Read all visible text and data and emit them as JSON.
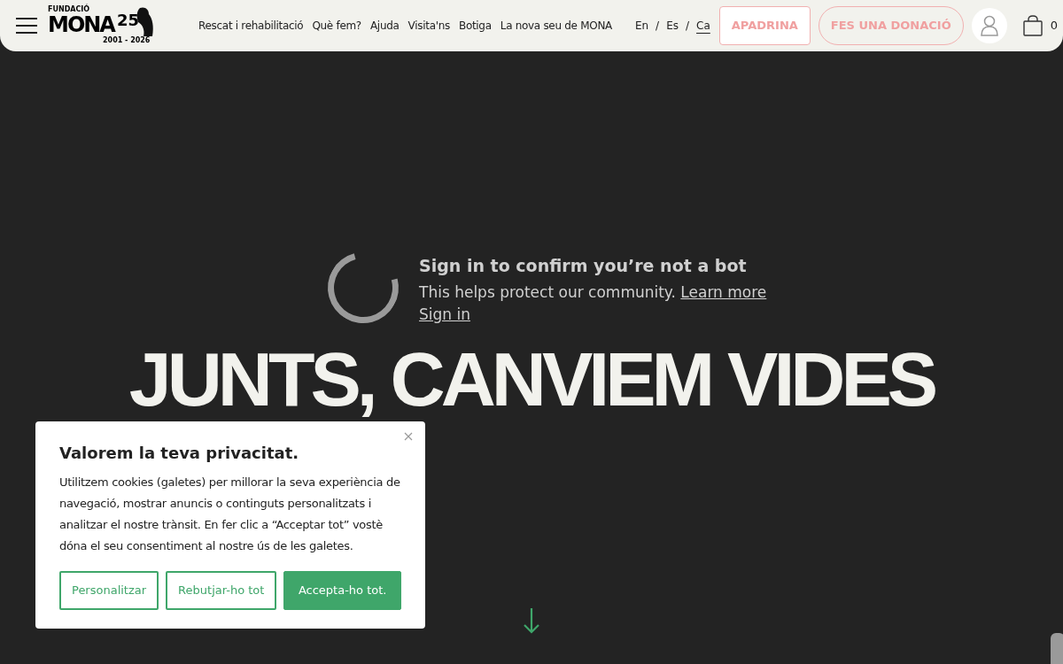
{
  "header": {
    "logo": {
      "top": "FUNDACIÓ",
      "name": "MONA",
      "number": "25",
      "years": "2001 - 2026"
    },
    "nav": [
      "Rescat i rehabilitació",
      "Què fem?",
      "Ajuda",
      "Visita'ns",
      "Botiga",
      "La nova seu de MONA"
    ],
    "languages": [
      {
        "label": "En",
        "selected": false
      },
      {
        "label": "Es",
        "selected": false
      },
      {
        "label": "Ca",
        "selected": true
      }
    ],
    "separator": "/",
    "sponsor_button": "APADRINA",
    "donate_button": "FES UNA DONACIÓ",
    "cart_count": "0"
  },
  "hero": {
    "title": "JUNTS, CANVIEM VIDES",
    "video_notice": {
      "heading": "Sign in to confirm you’re not a bot",
      "text": "This helps protect our community.",
      "link": "Learn more",
      "sign_in": "Sign in"
    }
  },
  "cookie_banner": {
    "title": "Valorem la teva privacitat.",
    "text": "Utilitzem cookies (galetes) per millorar la seva experiència de navegació, mostrar anuncis o continguts personalitzats i analitzar el nostre trànsit. En fer clic a “Acceptar tot” vostè dóna el seu consentiment al nostre ús de les galetes.",
    "buttons": [
      {
        "label": "Personalitzar",
        "kind": "outline"
      },
      {
        "label": "Rebutjar-ho tot",
        "kind": "outline"
      },
      {
        "label": "Accepta-ho tot.",
        "kind": "filled"
      }
    ]
  }
}
